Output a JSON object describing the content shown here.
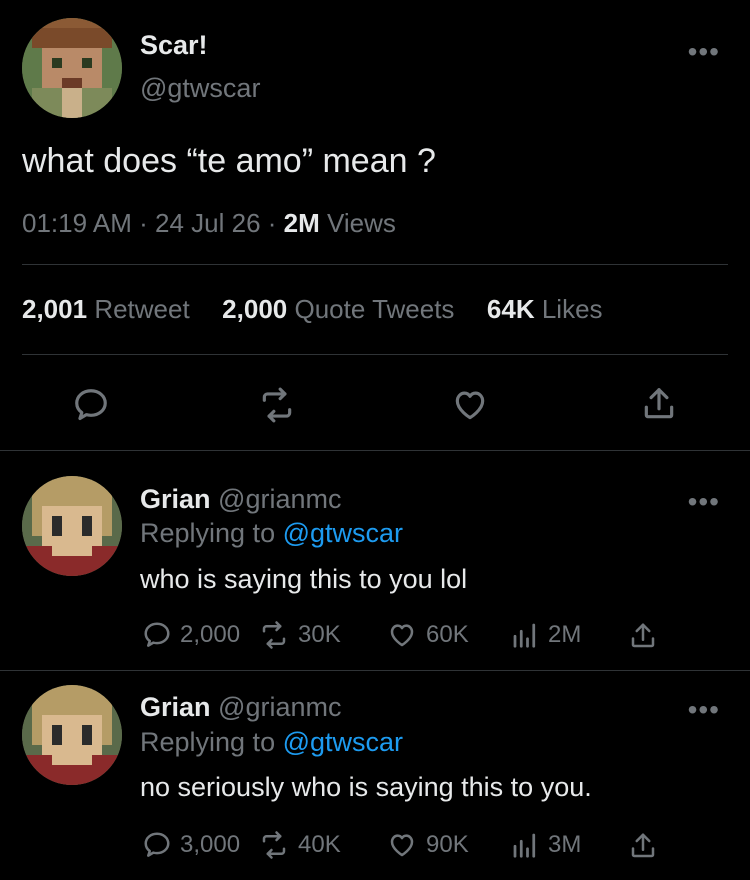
{
  "tweet": {
    "author_name": "Scar!",
    "author_handle": "@gtwscar",
    "text": "what does “te amo” mean ?",
    "time": "01:19 AM",
    "date": "24 Jul 26",
    "separator": "·",
    "views_count": "2M",
    "views_label": "Views",
    "retweets_count": "2,001",
    "retweets_label": "Retweet",
    "quotes_count": "2,000",
    "quotes_label": "Quote Tweets",
    "likes_count": "64K",
    "likes_label": "Likes",
    "more": "•••"
  },
  "replies": [
    {
      "author_name": "Grian",
      "author_handle": "@grianmc",
      "replying_prefix": "Replying to",
      "replying_handle": "@gtwscar",
      "text": "who is saying this to you lol",
      "replies": "2,000",
      "retweets": "30K",
      "likes": "60K",
      "views": "2M",
      "more": "•••"
    },
    {
      "author_name": "Grian",
      "author_handle": "@grianmc",
      "replying_prefix": "Replying to",
      "replying_handle": "@gtwscar",
      "text": "no seriously who is saying this to you.",
      "replies": "3,000",
      "retweets": "40K",
      "likes": "90K",
      "views": "3M",
      "more": "•••"
    }
  ],
  "colors": {
    "background": "#000000",
    "text": "#e7e9ea",
    "secondary": "#71767b",
    "link": "#1d9bf0",
    "divider": "#2f3336"
  },
  "icons": {
    "reply": "reply-icon",
    "retweet": "retweet-icon",
    "like": "heart-icon",
    "share": "share-icon",
    "views": "views-icon"
  }
}
